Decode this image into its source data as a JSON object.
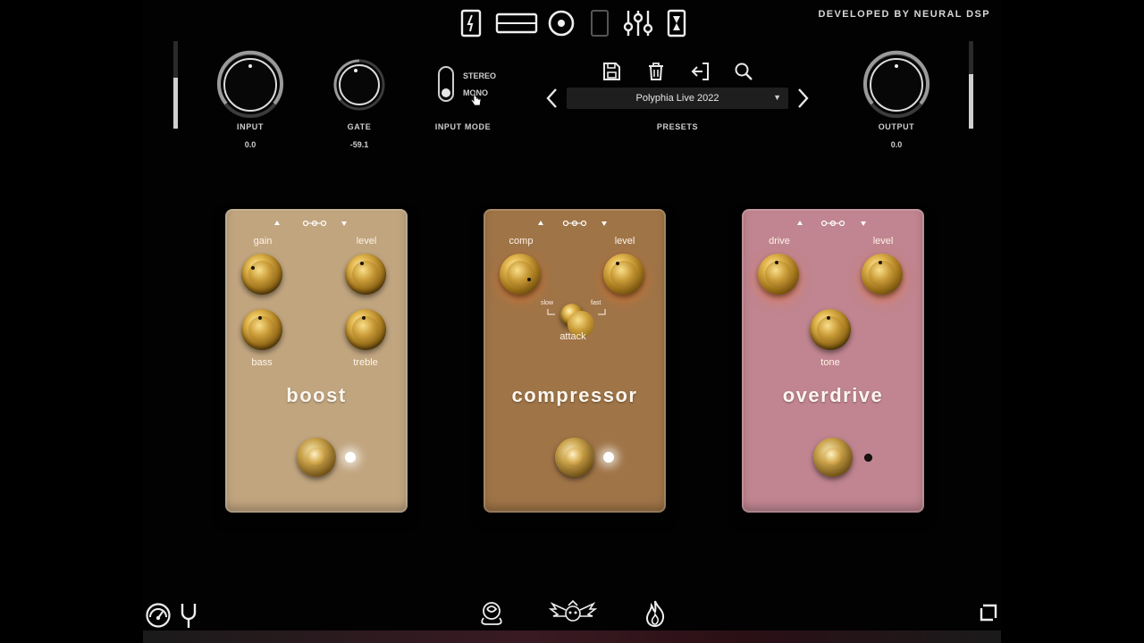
{
  "header": {
    "developer": "DEVELOPED BY NEURAL DSP",
    "nav_icons": [
      "pedal-fx-icon",
      "amp-head-icon",
      "cabinet-speaker-icon",
      "post-fx-icon",
      "mixer-sliders-icon",
      "time-fx-icon"
    ]
  },
  "input": {
    "label": "INPUT",
    "value": "0.0",
    "meter_level": 0.58
  },
  "gate": {
    "label": "GATE",
    "value": "-59.1"
  },
  "input_mode": {
    "label": "INPUT MODE",
    "options": [
      "STEREO",
      "MONO"
    ],
    "selected": "MONO"
  },
  "presets": {
    "label": "PRESETS",
    "current": "Polyphia Live 2022"
  },
  "output": {
    "label": "OUTPUT",
    "value": "0.0",
    "meter_level": 0.62
  },
  "pedals": {
    "boost": {
      "name": "boost",
      "color": "#c1a57f",
      "knobs": [
        "gain",
        "level",
        "bass",
        "treble"
      ],
      "led": "on"
    },
    "compressor": {
      "name": "compressor",
      "color": "#9f7447",
      "knobs": [
        "comp",
        "level"
      ],
      "attack": {
        "label": "attack",
        "slow": "slow",
        "fast": "fast"
      },
      "led": "on"
    },
    "overdrive": {
      "name": "overdrive",
      "color": "#c08590",
      "knobs": [
        "drive",
        "level",
        "tone"
      ],
      "led": "off"
    }
  },
  "footer": {
    "icons": [
      "metronome-icon",
      "tuner-fork-icon",
      "rose-logo-icon",
      "wings-emblem-icon",
      "flame-icon",
      "resize-icon"
    ]
  }
}
